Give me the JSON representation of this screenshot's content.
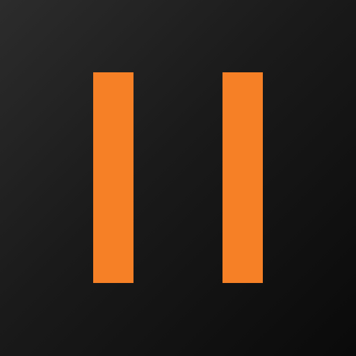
{
  "icon": {
    "name": "pause-icon",
    "bar_color": "#f68026",
    "background_top_left": "#2c2c2c",
    "background_bottom_right": "#0a0a0a"
  }
}
